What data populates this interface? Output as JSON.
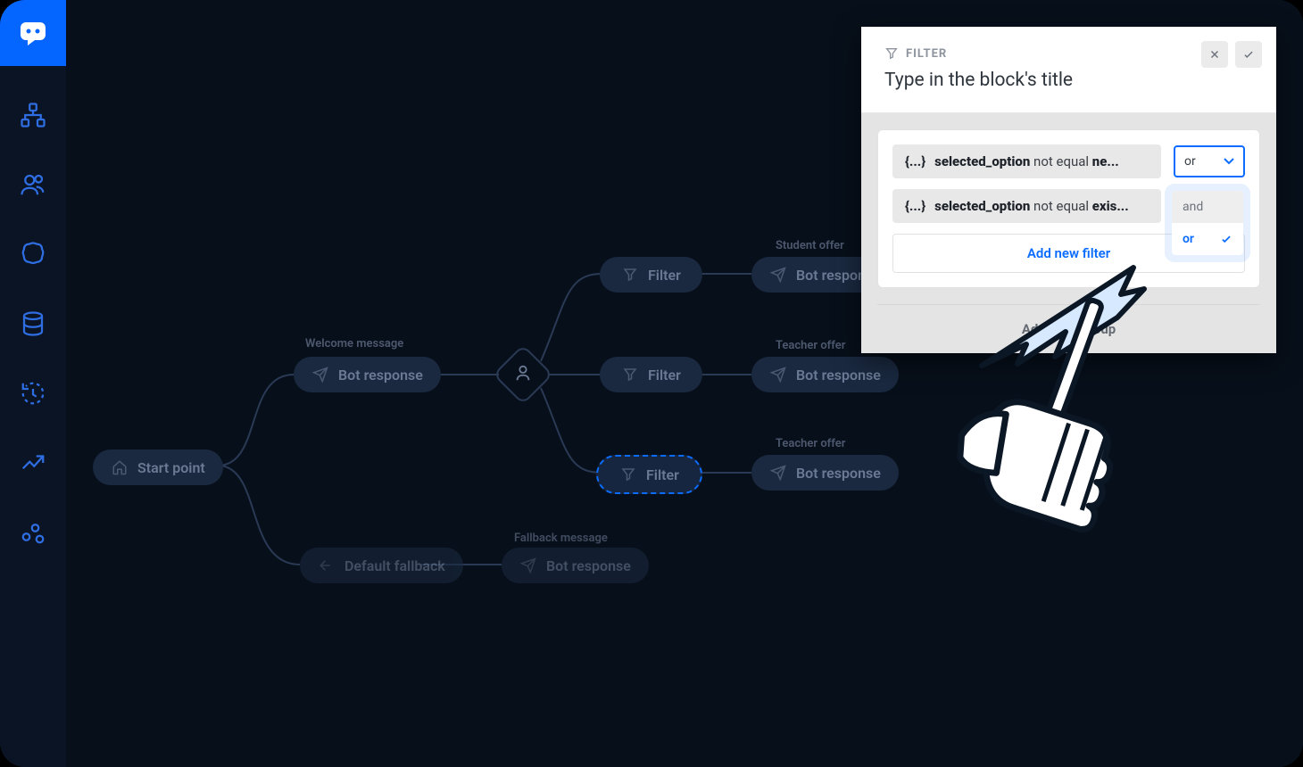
{
  "sidebar": {
    "icons": [
      "sitemap",
      "users",
      "brain",
      "database",
      "history",
      "trend",
      "scatter"
    ]
  },
  "canvas": {
    "start": "Start point",
    "welcome_label": "Welcome message",
    "bot_response": "Bot response",
    "filter": "Filter",
    "fallback": "Default fallback",
    "fallback_label": "Fallback message",
    "student_offer": "Student offer",
    "teacher_offer_top": "Teacher offer",
    "teacher_offer_bottom": "Teacher offer"
  },
  "panel": {
    "eyebrow": "FILTER",
    "title": "Type in the block's title",
    "filters": [
      {
        "attr": "selected_option",
        "op": "not equal",
        "val": "ne..."
      },
      {
        "attr": "selected_option",
        "op": "not equal",
        "val": "exis..."
      }
    ],
    "connector": "or",
    "add_filter": "Add new filter",
    "add_group": "Add filter group",
    "dropdown": {
      "and": "and",
      "or": "or"
    }
  }
}
